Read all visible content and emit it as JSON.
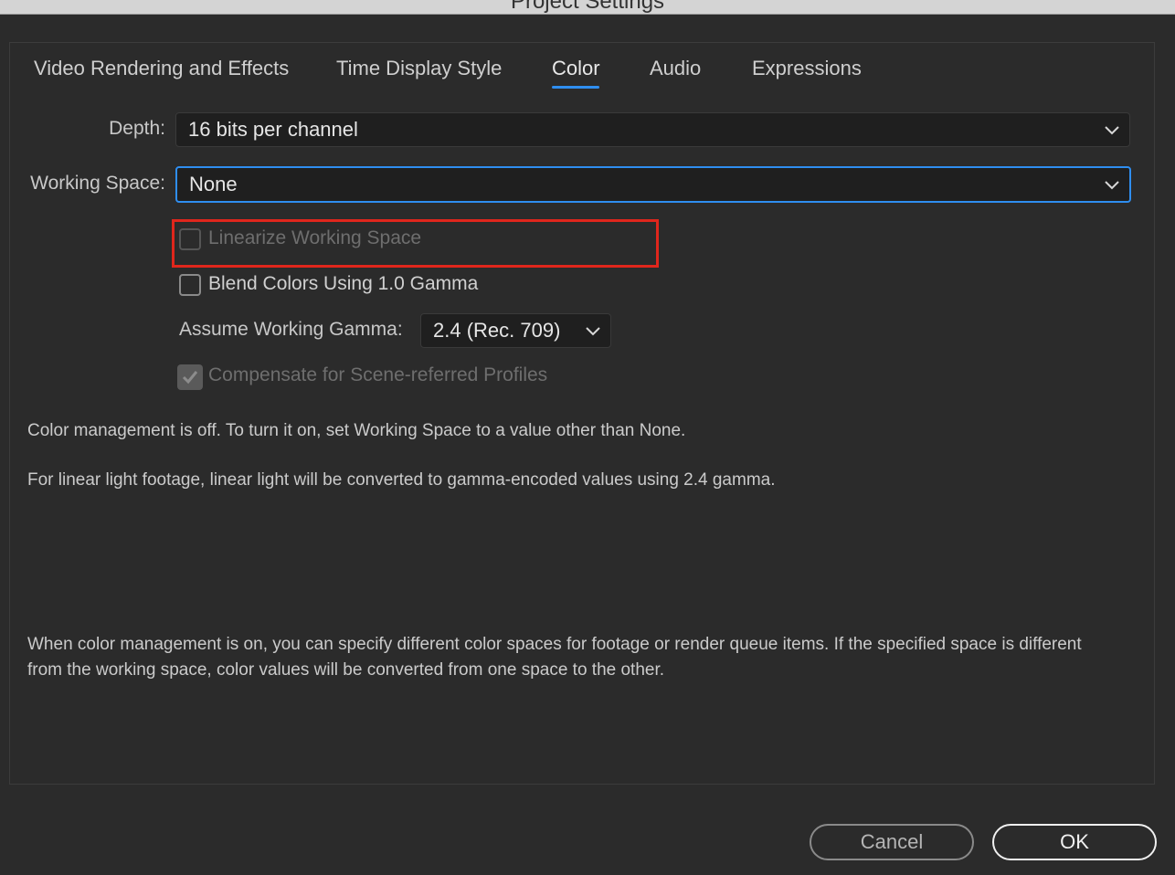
{
  "window": {
    "title": "Project Settings"
  },
  "tabs": [
    {
      "label": "Video Rendering and Effects",
      "active": false
    },
    {
      "label": "Time Display Style",
      "active": false
    },
    {
      "label": "Color",
      "active": true
    },
    {
      "label": "Audio",
      "active": false
    },
    {
      "label": "Expressions",
      "active": false
    }
  ],
  "depth": {
    "label": "Depth:",
    "value": "16 bits per channel"
  },
  "working_space": {
    "label": "Working Space:",
    "value": "None"
  },
  "linearize": {
    "label": "Linearize Working Space",
    "checked": false,
    "enabled": false
  },
  "blend_colors": {
    "label": "Blend Colors Using 1.0 Gamma",
    "checked": false,
    "enabled": true
  },
  "working_gamma": {
    "label": "Assume Working Gamma:",
    "value": "2.4 (Rec. 709)"
  },
  "compensate": {
    "label": "Compensate for Scene-referred Profiles",
    "checked": true,
    "enabled": false
  },
  "info": {
    "line1": "Color management is off. To turn it on, set Working Space to a value other than None.",
    "line2": "For linear light footage, linear light will be converted to gamma-encoded values using 2.4 gamma.",
    "line3": "When color management is on, you can specify different color spaces for footage or render queue items. If the specified space is different from the working space, color values will be converted from one space to the other."
  },
  "buttons": {
    "cancel": "Cancel",
    "ok": "OK"
  },
  "colors": {
    "accent": "#2f8ef0",
    "highlight": "#e0261c",
    "background": "#2b2b2b"
  }
}
